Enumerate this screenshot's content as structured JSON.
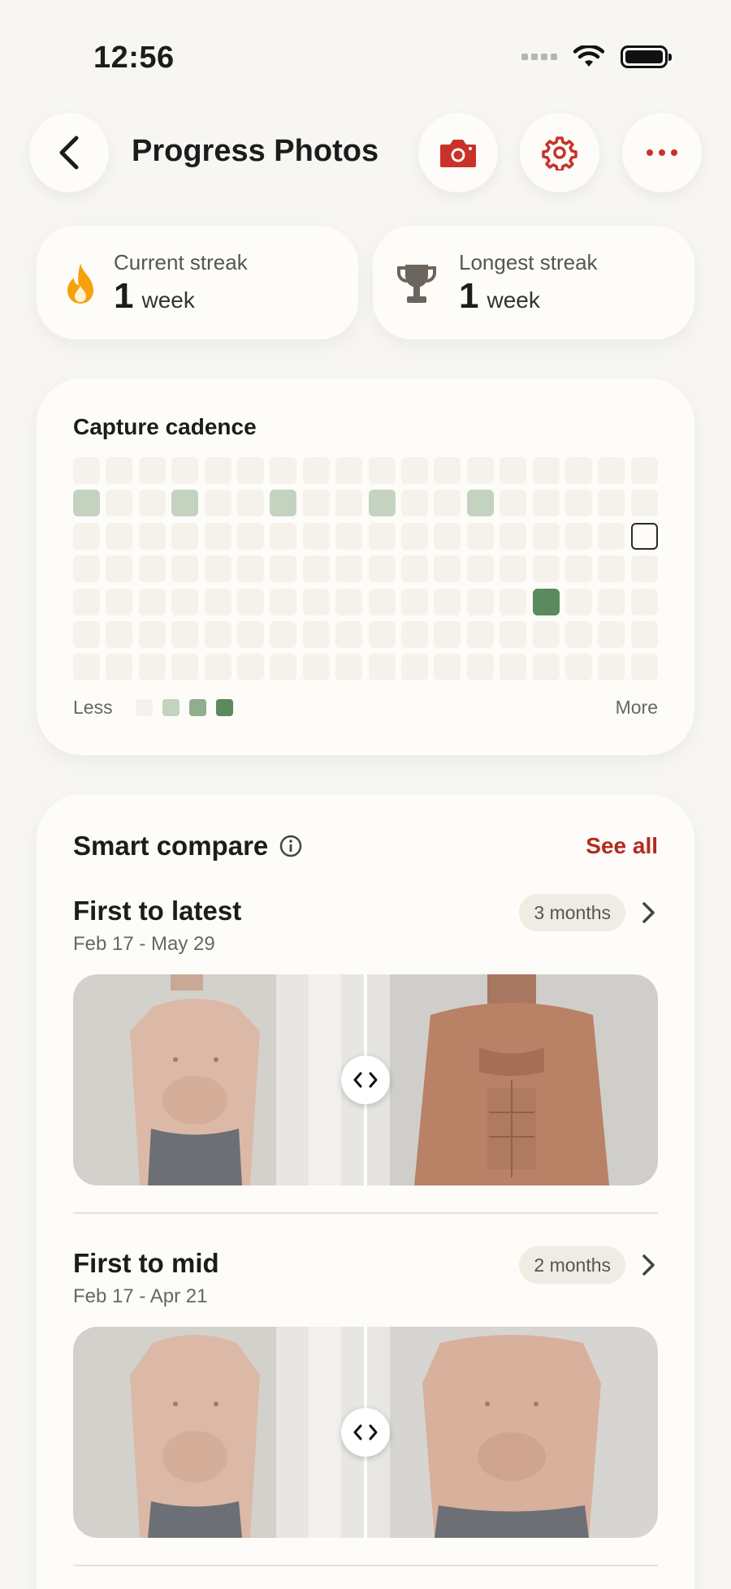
{
  "status": {
    "time": "12:56"
  },
  "header": {
    "title": "Progress Photos",
    "back_icon": "chevron-left-icon",
    "camera_icon": "camera-icon",
    "settings_icon": "gear-icon",
    "more_icon": "more-horizontal-icon",
    "accent": "#c8322a"
  },
  "streaks": {
    "current": {
      "label": "Current streak",
      "value": "1",
      "unit": "week",
      "icon": "flame-icon",
      "color": "#f5a20a"
    },
    "longest": {
      "label": "Longest streak",
      "value": "1",
      "unit": "week",
      "icon": "trophy-icon",
      "color": "#6b655d"
    }
  },
  "cadence": {
    "title": "Capture cadence",
    "legend_less": "Less",
    "legend_more": "More",
    "colors": [
      "#f5f2ec",
      "#c3d3c0",
      "#8fae8d",
      "#5a8a5e"
    ],
    "rows": 7,
    "cols": 18,
    "filled": [
      {
        "row": 1,
        "col": 0,
        "level": 1
      },
      {
        "row": 1,
        "col": 3,
        "level": 1
      },
      {
        "row": 1,
        "col": 6,
        "level": 1
      },
      {
        "row": 1,
        "col": 9,
        "level": 1
      },
      {
        "row": 1,
        "col": 12,
        "level": 1
      },
      {
        "row": 4,
        "col": 14,
        "level": 3
      }
    ],
    "today": {
      "row": 2,
      "col": 17
    }
  },
  "compare": {
    "title": "Smart compare",
    "info_icon": "info-icon",
    "see_all": "See all",
    "items": [
      {
        "title": "First to latest",
        "dates": "Feb 17 - May 29",
        "badge": "3 months",
        "swap_icon": "swap-arrows-icon"
      },
      {
        "title": "First to mid",
        "dates": "Feb 17 - Apr 21",
        "badge": "2 months",
        "swap_icon": "swap-arrows-icon"
      }
    ]
  }
}
